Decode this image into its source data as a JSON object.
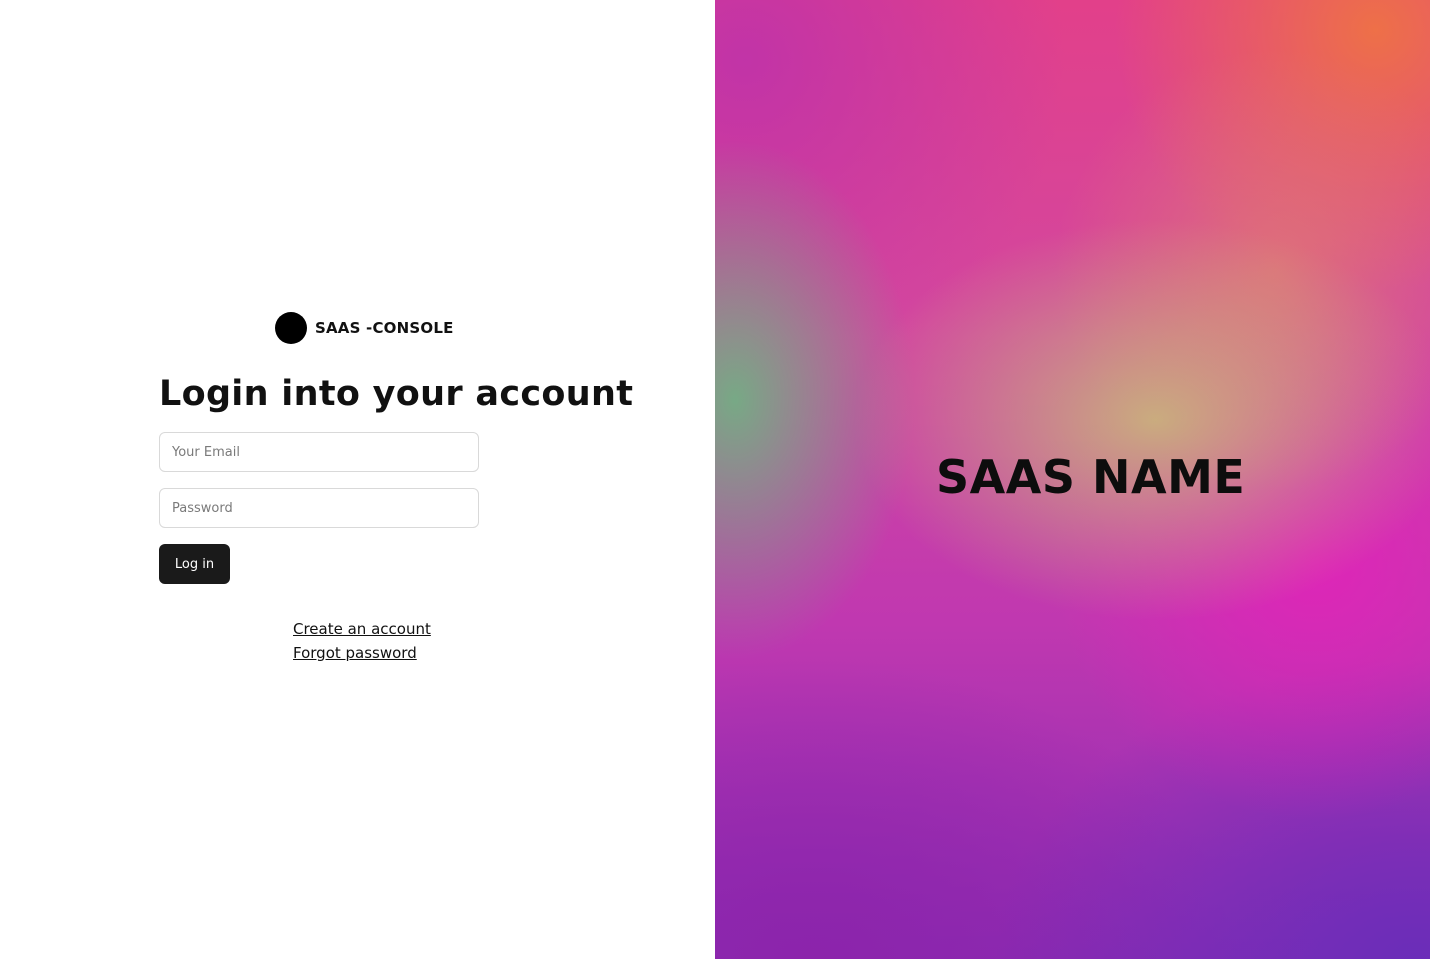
{
  "brand": {
    "logo_icon": "circle-logo-icon",
    "name": "SAAS -CONSOLE"
  },
  "login": {
    "title": "Login into your account",
    "email_placeholder": "Your Email",
    "password_placeholder": "Password",
    "submit_label": "Log in"
  },
  "links": {
    "create_account": "Create an account",
    "forgot_password": "Forgot password"
  },
  "hero": {
    "name": "SAAS NAME",
    "colors": {
      "pink": "#e2408a",
      "magenta": "#e023b9",
      "purple": "#692db9",
      "orange": "#f0783c",
      "green": "#6eb482",
      "tan": "#c8be78"
    }
  },
  "theme": {
    "button_bg": "#1a1a1a",
    "text": "#111111"
  }
}
